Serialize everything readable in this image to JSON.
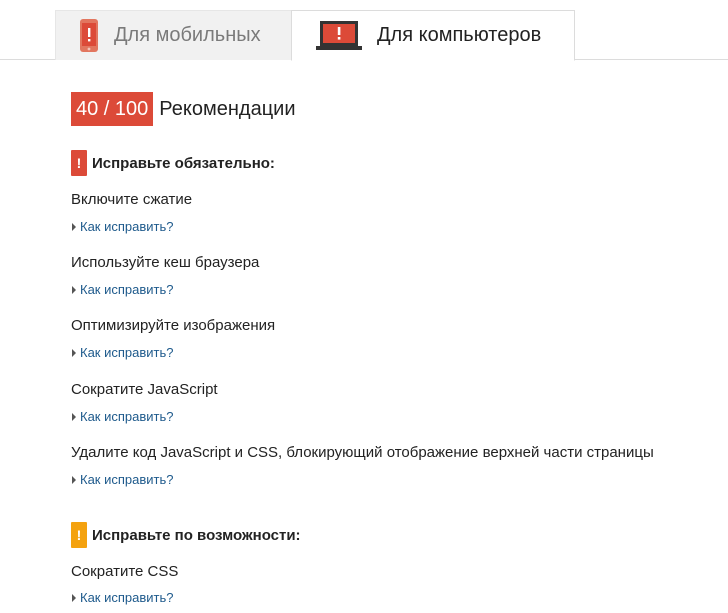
{
  "tabs": {
    "mobile_label": "Для мобильных",
    "desktop_label": "Для компьютеров",
    "active": "desktop"
  },
  "score": {
    "value_text": "40 / 100",
    "value": 40,
    "max": 100,
    "label": "Рекомендации",
    "color": "#dc4a38"
  },
  "sections": {
    "must_fix": {
      "icon_glyph": "!",
      "title": "Исправьте обязательно:",
      "color": "#dc4a38",
      "rules": [
        {
          "title": "Включите сжатие",
          "howto": "Как исправить?"
        },
        {
          "title": "Используйте кеш браузера",
          "howto": "Как исправить?"
        },
        {
          "title": "Оптимизируйте изображения",
          "howto": "Как исправить?"
        },
        {
          "title": "Сократите JavaScript",
          "howto": "Как исправить?"
        },
        {
          "title": "Удалите код JavaScript и CSS, блокирующий отображение верхней части страницы",
          "howto": "Как исправить?"
        }
      ]
    },
    "should_fix": {
      "icon_glyph": "!",
      "title": "Исправьте по возможности:",
      "color": "#f4a20f",
      "rules": [
        {
          "title": "Сократите CSS",
          "howto": "Как исправить?"
        }
      ]
    }
  },
  "icons": {
    "mobile_tab": "phone-warning-icon",
    "desktop_tab": "laptop-warning-icon",
    "howto_arrow": "triangle-right-icon"
  }
}
